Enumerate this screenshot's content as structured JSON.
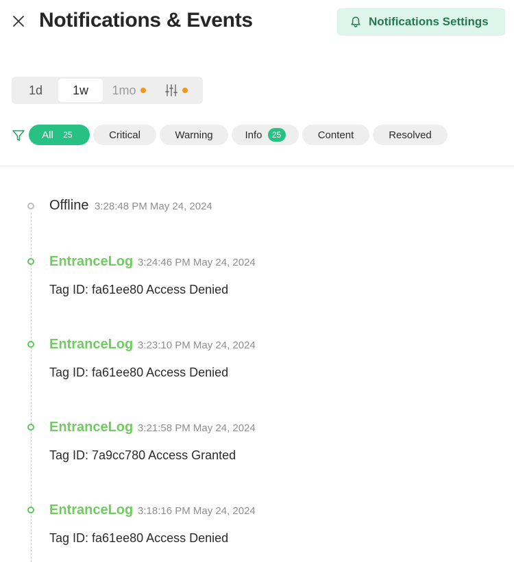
{
  "header": {
    "title": "Notifications & Events",
    "settings_label": "Notifications Settings"
  },
  "time_range": {
    "options": [
      "1d",
      "1w",
      "1mo"
    ],
    "selected": "1w",
    "indicator_color": "#f0961f"
  },
  "filters": [
    {
      "label": "All",
      "count": "25",
      "active": true
    },
    {
      "label": "Critical"
    },
    {
      "label": "Warning"
    },
    {
      "label": "Info",
      "count": "25"
    },
    {
      "label": "Content"
    },
    {
      "label": "Resolved"
    }
  ],
  "events": [
    {
      "title": "Offline",
      "time": "3:28:48 PM May 24, 2024",
      "detail": "",
      "status": "neutral"
    },
    {
      "title": "EntranceLog",
      "time": "3:24:46 PM May 24, 2024",
      "detail": "Tag ID: fa61ee80 Access Denied",
      "status": "green"
    },
    {
      "title": "EntranceLog",
      "time": "3:23:10 PM May 24, 2024",
      "detail": "Tag ID: fa61ee80 Access Denied",
      "status": "green"
    },
    {
      "title": "EntranceLog",
      "time": "3:21:58 PM May 24, 2024",
      "detail": "Tag ID: 7a9cc780 Access Granted",
      "status": "green"
    },
    {
      "title": "EntranceLog",
      "time": "3:18:16 PM May 24, 2024",
      "detail": "Tag ID: fa61ee80 Access Denied",
      "status": "green"
    }
  ],
  "colors": {
    "accent_green": "#27c184",
    "event_title_green": "#6ecd5e",
    "settings_bg": "#ddf5ea",
    "settings_text": "#237a52"
  },
  "icons": {
    "close": "close-icon",
    "bell": "bell-icon",
    "sliders": "sliders-icon",
    "filter": "filter-icon"
  }
}
